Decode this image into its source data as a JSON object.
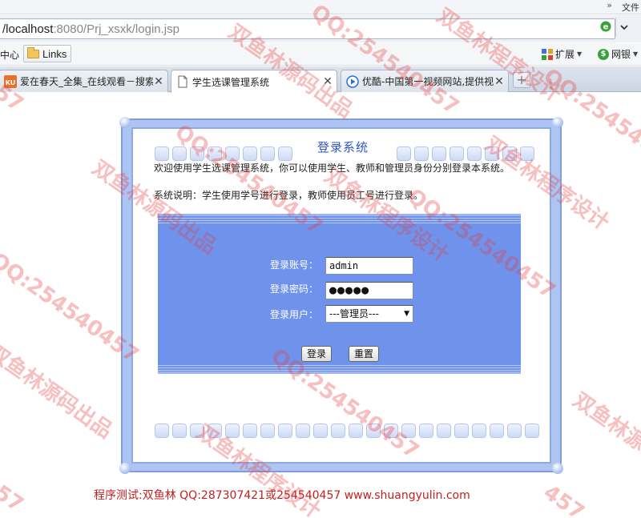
{
  "browser": {
    "menu_file": "文件",
    "chevron": "»",
    "address": {
      "host": "/localhost",
      "port": ":8080",
      "path": "/Prj_xsxk/login.jsp"
    },
    "favbar": {
      "center_label": "中心",
      "links_label": "Links",
      "extensions_label": "扩展",
      "bank_label": "网银"
    },
    "tabs": [
      {
        "title": "爱在春天_全集_在线观看－搜索",
        "favicon": "soku-icon"
      },
      {
        "title": "学生选课管理系统",
        "favicon": "page-icon"
      },
      {
        "title": "优酷-中国第一视频网站,提供视",
        "favicon": "youku-play-icon"
      }
    ],
    "new_tab_symbol": "+"
  },
  "page": {
    "title": "登录系统",
    "welcome": "欢迎使用学生选课管理系统，你可以使用学生、教师和管理员身份分别登录本系统。",
    "description": "系统说明：学生使用学号进行登录，教师使用员工号进行登录。",
    "form": {
      "account_label": "登录账号：",
      "account_value": "admin",
      "password_label": "登录密码：",
      "password_mask": "●●●●●",
      "user_type_label": "登录用户：",
      "user_type_selected": "---管理员---",
      "login_button": "登录",
      "reset_button": "重置"
    },
    "footer": "程序测试:双鱼林 QQ:287307421或254540457 www.shuangyulin.com"
  },
  "watermarks": [
    "双鱼林源码出品",
    "QQ:254540457",
    "双鱼林程序设计",
    "457"
  ],
  "colors": {
    "accent_blue": "#6f93ec",
    "title_blue": "#2f54c8",
    "footer_red": "#c41f1f",
    "watermark_red": "#e83c3c"
  }
}
